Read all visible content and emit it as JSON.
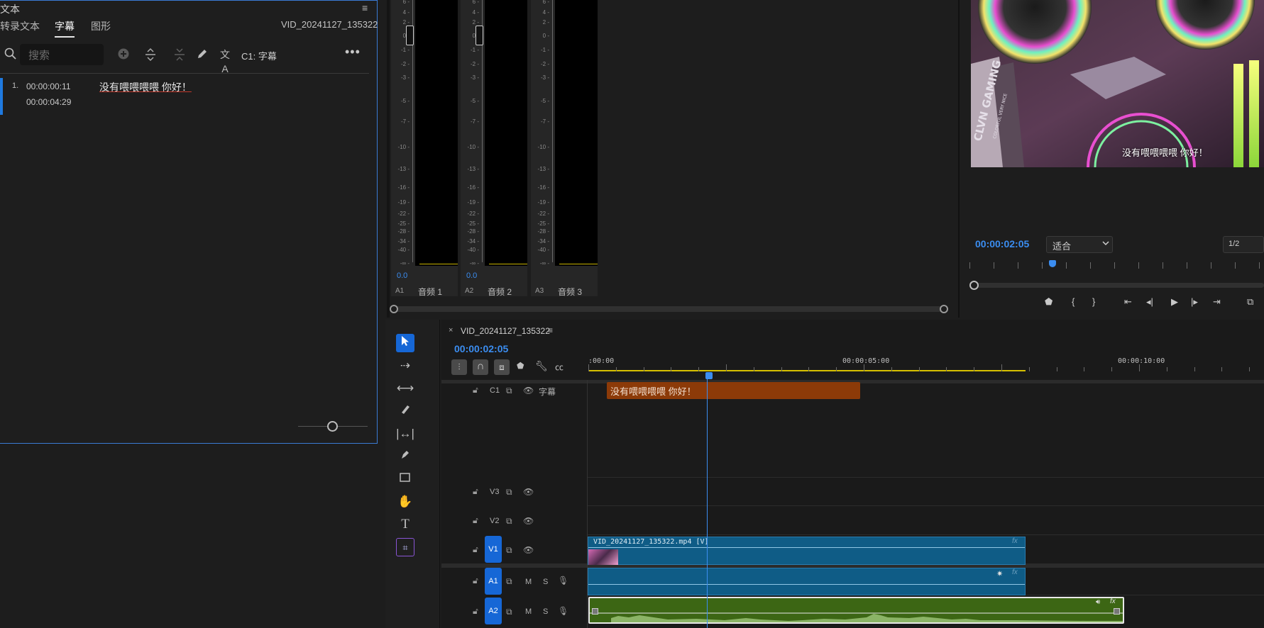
{
  "text_panel": {
    "title_fragment": "文本",
    "tabs": [
      "转录文本",
      "字幕",
      "图形"
    ],
    "active_tab": "字幕",
    "sequence_name": "VID_20241127_135322",
    "search_placeholder": "搜索",
    "track_label": "C1: 字幕",
    "captions": [
      {
        "index": "1.",
        "in": "00:00:00:11",
        "out": "00:00:04:29",
        "text": "没有喂喂喂喂 你好！"
      }
    ]
  },
  "audio_meters": {
    "scale": [
      "6",
      "4",
      "2",
      "0",
      "-1",
      "-2",
      "-3",
      "-5",
      "-7",
      "-10",
      "-13",
      "-16",
      "-19",
      "-22",
      "-25",
      "-28",
      "-34",
      "-40",
      "-∞"
    ],
    "channels": [
      {
        "id": "A1",
        "name": "音频 1",
        "level": "0.0"
      },
      {
        "id": "A2",
        "name": "音频 2",
        "level": "0.0"
      },
      {
        "id": "A3",
        "name": "音频 3",
        "level": ""
      }
    ]
  },
  "program_monitor": {
    "caption_overlay": "没有喂喂喂喂  你好！",
    "timecode": "00:00:02:05",
    "fit": "适合",
    "resolution": "1/2",
    "playhead_fraction": 0.27,
    "brand_text": "CLVN GAMING",
    "brand_sub": "COLORFUL VERY NICE"
  },
  "timeline": {
    "sequence_name": "VID_20241127_135322",
    "timecode": "00:00:02:05",
    "ruler_labels": [
      ":00:00",
      "00:00:05:00",
      "00:00:10:00"
    ],
    "tracks": {
      "c1": {
        "id": "C1",
        "name": "字幕",
        "clip_text": "没有喂喂喂喂  你好！"
      },
      "v3": {
        "id": "V3"
      },
      "v2": {
        "id": "V2"
      },
      "v1": {
        "id": "V1",
        "clip_name": "VID_20241127_135322.mp4 [V]",
        "fx": "fx"
      },
      "a1": {
        "id": "A1",
        "m": "M",
        "s": "S",
        "fx": "fx"
      },
      "a2": {
        "id": "A2",
        "m": "M",
        "s": "S",
        "fx": "fx"
      }
    }
  },
  "colors": {
    "accent_blue": "#1667d6",
    "timecode_blue": "#3b8df0",
    "caption_clip": "#8c3a08",
    "video_clip": "#0f5c86",
    "audio_clip": "#3c6614",
    "meter_yellow": "#c8b400"
  }
}
